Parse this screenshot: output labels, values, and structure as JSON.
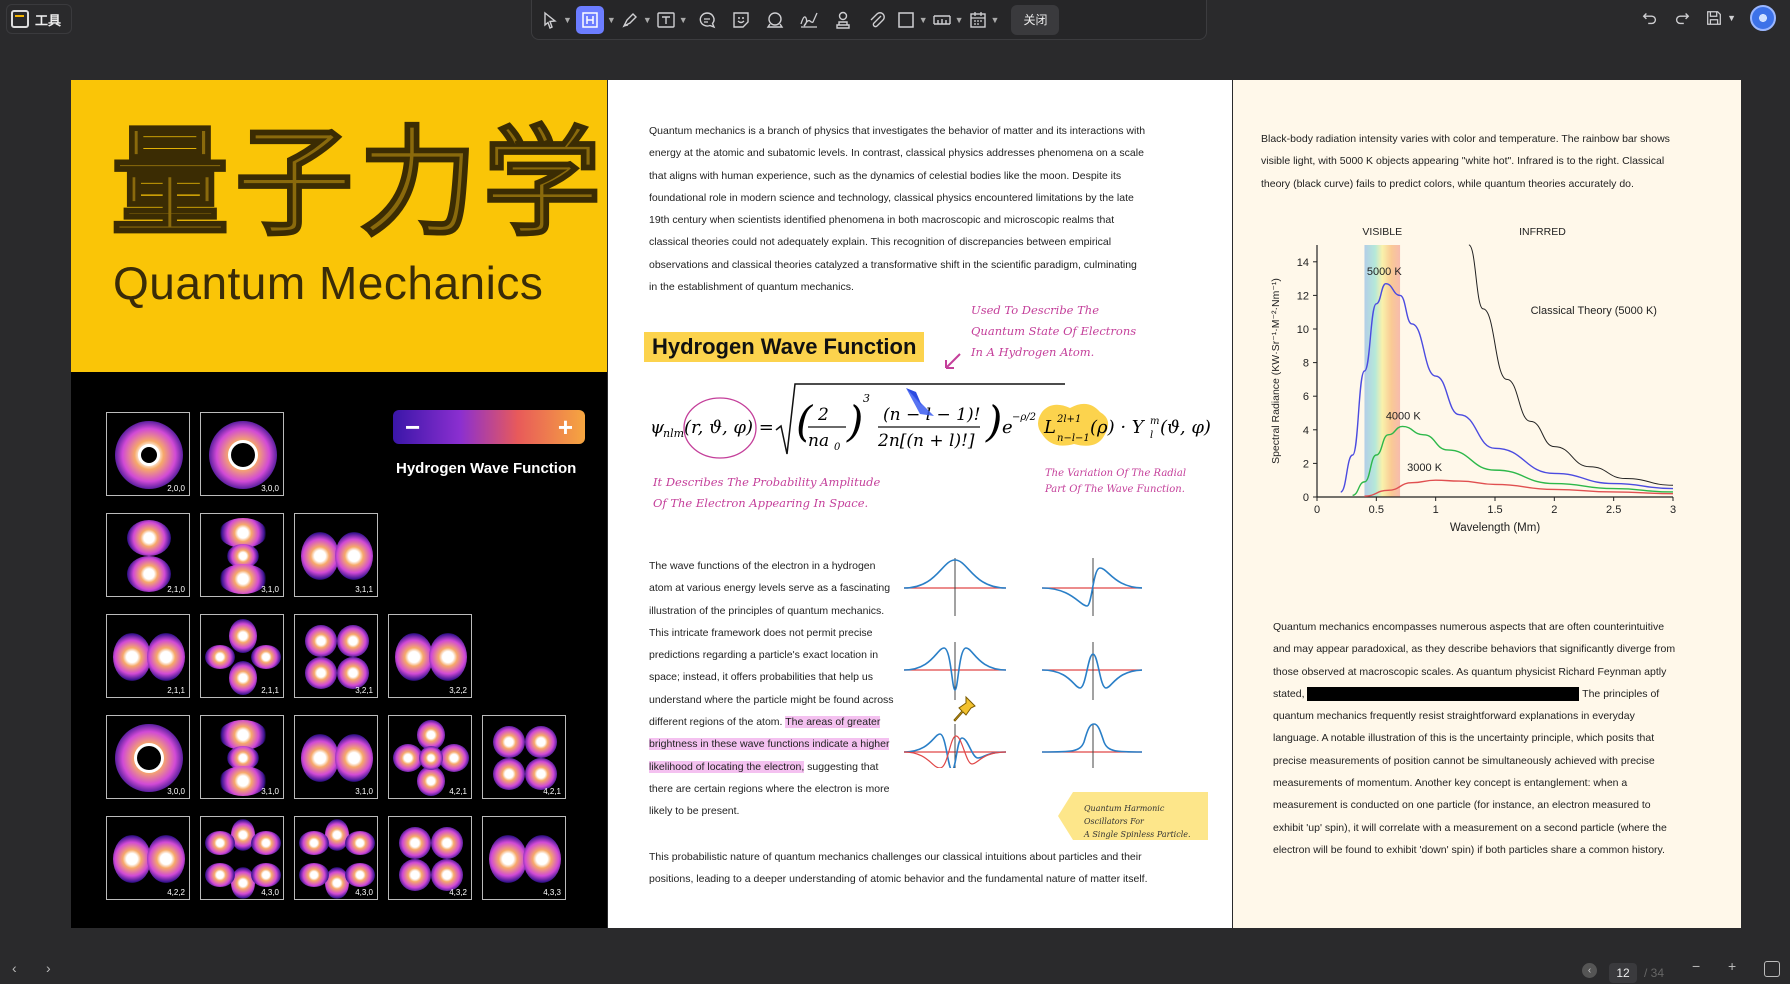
{
  "app": {
    "tool_label": "工具"
  },
  "toolbar": {
    "close_label": "关闭",
    "tools": [
      "select",
      "text-box",
      "marker",
      "text-tool",
      "comment",
      "sticker",
      "stamp",
      "signature",
      "user-stamp",
      "attachment",
      "shape",
      "measure",
      "calendar"
    ]
  },
  "page1": {
    "cn_title": "量子力学",
    "en_title": "Quantum Mechanics",
    "slider_minus": "−",
    "slider_plus": "+",
    "slider_label": "Hydrogen Wave Function",
    "orbitals": [
      "2,0,0",
      "3,0,0",
      "2,1,0",
      "3,1,0",
      "3,1,1",
      "2,1,1",
      "2,1,1",
      "3,2,1",
      "3,2,2",
      "3,0,0",
      "3,1,0",
      "3,1,0",
      "4,2,1",
      "4,2,1",
      "4,2,2",
      "4,3,0",
      "4,3,0",
      "4,3,2",
      "4,3,3"
    ]
  },
  "page2": {
    "intro_lines": [
      "Quantum mechanics is a branch of physics that investigates the behavior of matter and its interactions with",
      "energy at the atomic and subatomic levels. In contrast, classical physics addresses phenomena on a scale",
      "that aligns with human experience, such as the dynamics of celestial bodies like the moon. Despite its",
      "foundational role in modern science and technology, classical physics encountered limitations by the late",
      "19th century when scientists identified phenomena in both macroscopic and microscopic realms that",
      "classical theories could not adequately explain. This recognition of discrepancies between empirical",
      "observations and classical theories catalyzed a transformative shift in the scientific paradigm, culminating",
      "in the establishment of quantum mechanics."
    ],
    "heading": "Hydrogen Wave Function",
    "annot_top": [
      "Used To Describe The",
      "Quantum State Of Electrons",
      "In A Hydrogen Atom."
    ],
    "annot_left": [
      "It Describes The Probability Amplitude",
      "Of The Electron Appearing In Space."
    ],
    "annot_right": [
      "The Variation Of The Radial",
      "Part Of The Wave Function."
    ],
    "body_lines": [
      "The wave functions of the electron in a hydrogen",
      "atom at various energy levels serve as a fascinating",
      "illustration of the principles of quantum mechanics.",
      "This intricate framework does not permit precise",
      "predictions regarding a particle's exact location in",
      "space; instead, it offers probabilities that help us",
      "understand where the particle might be found across"
    ],
    "body_line8_plain": "different regions of the atom. ",
    "body_line8_hl": "The areas of greater",
    "body_line9_hl": "brightness in these wave functions indicate a higher",
    "body_line10_hl": "likelihood of locating the electron,",
    "body_line10_plain": " suggesting that",
    "body_line11": "there are certain regions where the electron is more",
    "body_line12": "likely to be present.",
    "sticky_note": [
      "Quantum Harmonic Oscillators For",
      "A Single Spinless Particle."
    ],
    "outro_lines": [
      "This probabilistic nature of quantum mechanics challenges our classical intuitions about particles and their",
      "positions, leading to a deeper understanding of atomic behavior and the fundamental nature of matter itself."
    ]
  },
  "page3": {
    "intro_lines": [
      "Black-body radiation intensity varies with color and temperature. The rainbow bar shows",
      "visible light, with 5000 K objects appearing \"white hot\". Infrared is to the right. Classical",
      "theory (black curve) fails to predict colors, while quantum theories accurately do."
    ],
    "body_lines": [
      "Quantum mechanics encompasses numerous aspects that are often counterintuitive",
      "and may appear paradoxical, as they describe behaviors that significantly diverge from",
      "those observed at macroscopic scales. As quantum physicist Richard Feynman aptly"
    ],
    "stated_prefix": "stated,",
    "stated_suffix": "The principles of",
    "body_lines_2": [
      "quantum mechanics frequently resist straightforward explanations in everyday",
      "language. A notable illustration of this is the uncertainty principle, which posits that",
      "precise measurements of position cannot be simultaneously achieved with precise",
      "measurements of momentum. Another key concept is entanglement: when a",
      "measurement is conducted on one particle (for instance, an electron measured to",
      "exhibit 'up' spin), it will correlate with a measurement on a second particle (where the",
      "electron will be found to exhibit 'down' spin) if both particles share a common history."
    ]
  },
  "chart_data": {
    "type": "line",
    "title": "",
    "xlabel": "Wavelength (Mm)",
    "ylabel": "Spectral Radiance (KW·Sr⁻¹·M⁻²·Nm⁻¹)",
    "xlim": [
      0,
      3
    ],
    "ylim": [
      0,
      15
    ],
    "xticks": [
      "0",
      "0.5",
      "1",
      "1.5",
      "2",
      "2.5",
      "3"
    ],
    "yticks": [
      "0",
      "2",
      "4",
      "6",
      "8",
      "10",
      "12",
      "14"
    ],
    "region_labels": [
      "VISIBLE",
      "INFRRED"
    ],
    "series": [
      {
        "name": "5000 K",
        "color": "#4b4be0",
        "x": [
          0.2,
          0.3,
          0.4,
          0.5,
          0.58,
          0.7,
          0.8,
          1.0,
          1.2,
          1.5,
          2.0,
          2.5,
          3.0
        ],
        "y": [
          0.3,
          2.5,
          7.5,
          11.5,
          12.7,
          12.0,
          10.3,
          7.2,
          4.9,
          2.9,
          1.4,
          0.8,
          0.5
        ]
      },
      {
        "name": "4000 K",
        "color": "#2db84a",
        "x": [
          0.3,
          0.4,
          0.5,
          0.6,
          0.72,
          0.9,
          1.1,
          1.5,
          2.0,
          2.5,
          3.0
        ],
        "y": [
          0.1,
          0.9,
          2.5,
          3.7,
          4.2,
          3.7,
          2.8,
          1.6,
          0.8,
          0.5,
          0.3
        ]
      },
      {
        "name": "3000 K",
        "color": "#e05050",
        "x": [
          0.4,
          0.6,
          0.8,
          1.0,
          1.2,
          1.5,
          2.0,
          2.5,
          3.0
        ],
        "y": [
          0.05,
          0.4,
          0.85,
          1.0,
          0.95,
          0.75,
          0.45,
          0.3,
          0.2
        ]
      },
      {
        "name": "Classical Theory (5000 K)",
        "color": "#222222",
        "x": [
          1.28,
          1.4,
          1.6,
          1.8,
          2.0,
          2.3,
          2.6,
          3.0
        ],
        "y": [
          15,
          11.2,
          7.0,
          4.5,
          3.0,
          1.8,
          1.1,
          0.7
        ]
      }
    ],
    "visible_band": [
      0.4,
      0.7
    ],
    "grid": false
  },
  "statusbar": {
    "page": "12",
    "total": "/ 34"
  }
}
